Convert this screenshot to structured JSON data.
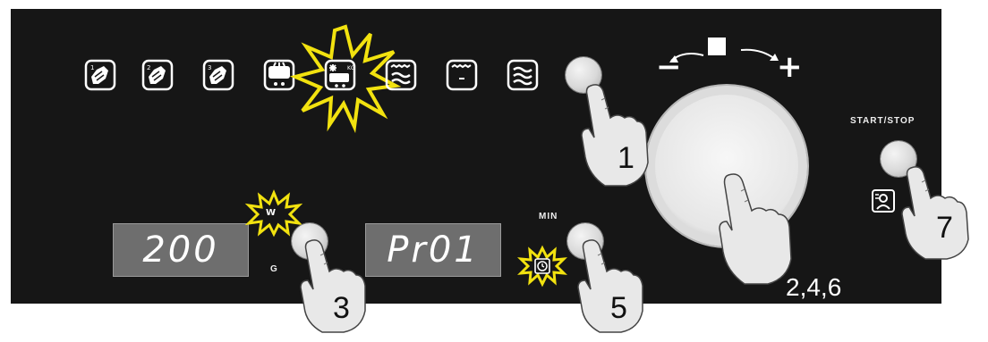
{
  "panel": {
    "mode_icons": [
      {
        "name": "defrost-meat-1-icon"
      },
      {
        "name": "defrost-meat-2-icon"
      },
      {
        "name": "defrost-meat-3-icon"
      },
      {
        "name": "defrost-bread-icon"
      },
      {
        "name": "defrost-cake-icon"
      },
      {
        "name": "microwave-grill-icon"
      },
      {
        "name": "grill-icon"
      },
      {
        "name": "microwave-icon"
      }
    ],
    "highlight_color": "#f2e20f",
    "knob_minus": "−",
    "knob_plus": "+",
    "start_stop_label": "START/STOP",
    "min_label": "MIN",
    "weight_unit_label": "G",
    "weight_badge_label": "W",
    "weight_display": "200",
    "program_display": "Pr01"
  },
  "steps": {
    "step_1": "1",
    "step_3": "3",
    "step_5": "5",
    "step_7": "7",
    "step_knob": "2,4,6"
  }
}
